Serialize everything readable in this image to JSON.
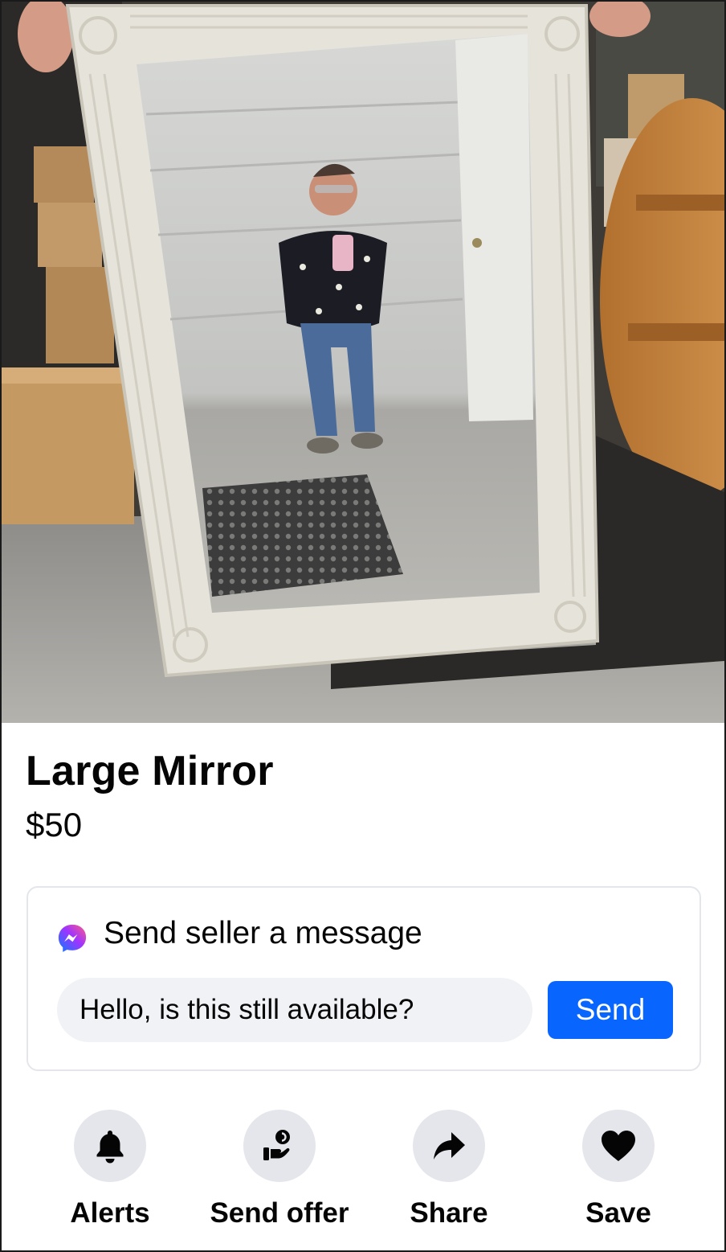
{
  "listing": {
    "title": "Large Mirror",
    "price": "$50",
    "photo_icon": "listing-photo-mirror"
  },
  "message": {
    "heading": "Send seller a message",
    "input_value": "Hello, is this still available?",
    "send_label": "Send",
    "icon": "messenger-icon"
  },
  "actions": [
    {
      "label": "Alerts",
      "icon": "bell-icon"
    },
    {
      "label": "Send offer",
      "icon": "offer-hand-icon"
    },
    {
      "label": "Share",
      "icon": "share-arrow-icon"
    },
    {
      "label": "Save",
      "icon": "heart-icon"
    }
  ],
  "colors": {
    "accent": "#0866ff",
    "icon_circle": "#e4e6eb",
    "input_bg": "#f0f2f5",
    "text": "#050505"
  }
}
